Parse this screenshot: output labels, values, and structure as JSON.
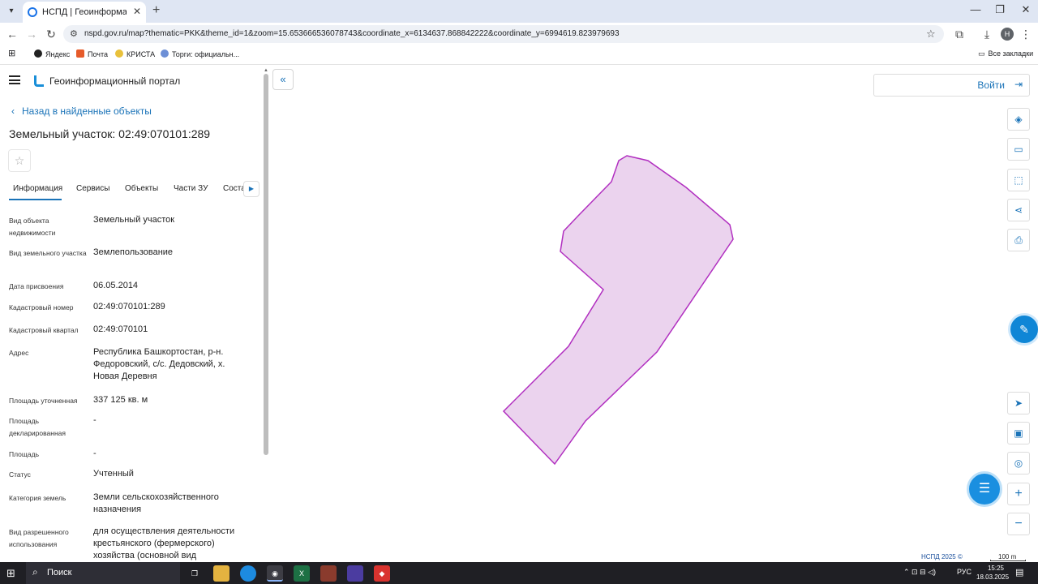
{
  "browser": {
    "tab_title": "НСПД | Геоинформационный",
    "url": "nspd.gov.ru/map?thematic=PKK&theme_id=1&zoom=15.653666536078743&coordinate_x=6134637.868842222&coordinate_y=6994619.823979693",
    "profile_initial": "Н",
    "bookmarks": [
      "Яндекс",
      "Почта",
      "КРИСТА",
      "Торги: официальн..."
    ],
    "all_bookmarks": "Все закладки"
  },
  "panel": {
    "portal_title": "Геоинформационный портал",
    "back_label": "Назад в найденные объекты",
    "object_title": "Земельный участок: 02:49:070101:289",
    "tabs": [
      "Информация",
      "Сервисы",
      "Объекты",
      "Части ЗУ",
      "Соста"
    ],
    "fields": [
      {
        "label": "Вид объекта недвижимости",
        "value": "Земельный участок"
      },
      {
        "label": "Вид земельного участка",
        "value": "Землепользование"
      },
      {
        "label": "Дата присвоения",
        "value": "06.05.2014"
      },
      {
        "label": "Кадастровый номер",
        "value": "02:49:070101:289"
      },
      {
        "label": "Кадастровый квартал",
        "value": "02:49:070101"
      },
      {
        "label": "Адрес",
        "value": "Республика Башкортостан, р-н. Федоровский, с/с. Дедовский, х. Новая Деревня"
      },
      {
        "label": "Площадь уточненная",
        "value": "337 125 кв. м"
      },
      {
        "label": "Площадь декларированная",
        "value": "-"
      },
      {
        "label": "Площадь",
        "value": "-"
      },
      {
        "label": "Статус",
        "value": "Учтенный"
      },
      {
        "label": "Категория земель",
        "value": "Земли сельскохозяйственного назначения"
      },
      {
        "label": "Вид разрешенного использования",
        "value": "для осуществления деятельности крестьянского (фермерского) хозяйства (основной вид"
      }
    ]
  },
  "map": {
    "login_label": "Войти",
    "copyright": "НСПД 2025 ©",
    "scale_label": "100 m",
    "parcel_fill": "#ebd3ee",
    "parcel_stroke": "#b12fc0"
  },
  "taskbar": {
    "search_label": "Поиск",
    "language": "РУС",
    "time": "15:25",
    "date": "18.03.2025"
  }
}
